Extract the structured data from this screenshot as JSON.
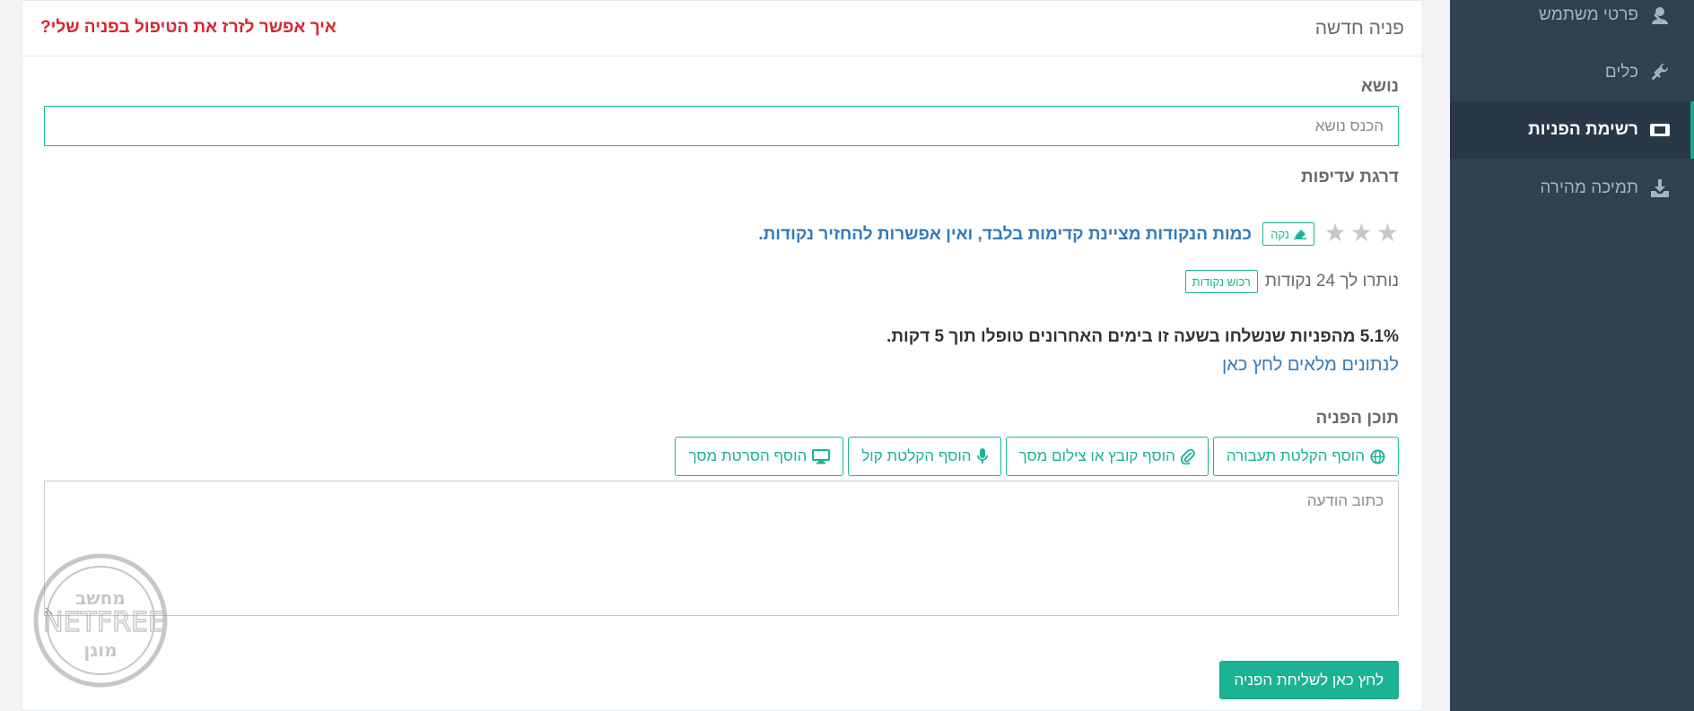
{
  "sidebar": {
    "items": [
      {
        "label": "פרטי משתמש",
        "icon": "user-icon",
        "has_chevron": true
      },
      {
        "label": "כלים",
        "icon": "wrench-icon",
        "has_chevron": true
      },
      {
        "label": "רשימת הפניות",
        "icon": "ticket-icon",
        "active": true
      },
      {
        "label": "תמיכה מהירה",
        "icon": "download-icon"
      }
    ]
  },
  "header": {
    "title": "פניה חדשה",
    "help_link": "איך אפשר לזרז את הטיפול בפניה שלי?"
  },
  "form": {
    "subject_label": "נושא",
    "subject_placeholder": "הכנס נושא",
    "priority_label": "דרגת עדיפות",
    "stars_count": 3,
    "clear_label": "נקה",
    "priority_note": "כמות הנקודות מציינת קדימות בלבד, ואין אפשרות להחזיר נקודות.",
    "points_left": "נותרו לך 24 נקודות",
    "buy_points_label": "רכוש נקודות",
    "stats_line": "5.1% מהפניות שנשלחו בשעה זו בימים האחרונים טופלו תוך 5 דקות.",
    "stats_link": "לנתונים מלאים לחץ כאן",
    "content_label": "תוכן הפניה",
    "attach_buttons": [
      {
        "label": "הוסף הקלטת תעבורה",
        "icon": "globe-icon"
      },
      {
        "label": "הוסף קובץ או צילום מסך",
        "icon": "paperclip-icon"
      },
      {
        "label": "הוסף הקלטת קול",
        "icon": "microphone-icon"
      },
      {
        "label": "הוסף הסרטת מסך",
        "icon": "monitor-icon"
      }
    ],
    "message_placeholder": "כתוב הודעה",
    "submit_label": "לחץ כאן לשליחת הפניה"
  },
  "watermark": {
    "text_top": "מחשב",
    "text_middle": "NETFREE",
    "text_bottom": "מוגן"
  },
  "colors": {
    "accent": "#1ab394",
    "sidebar": "#2f4050",
    "help_link": "#d9242e",
    "link": "#337ab7"
  }
}
